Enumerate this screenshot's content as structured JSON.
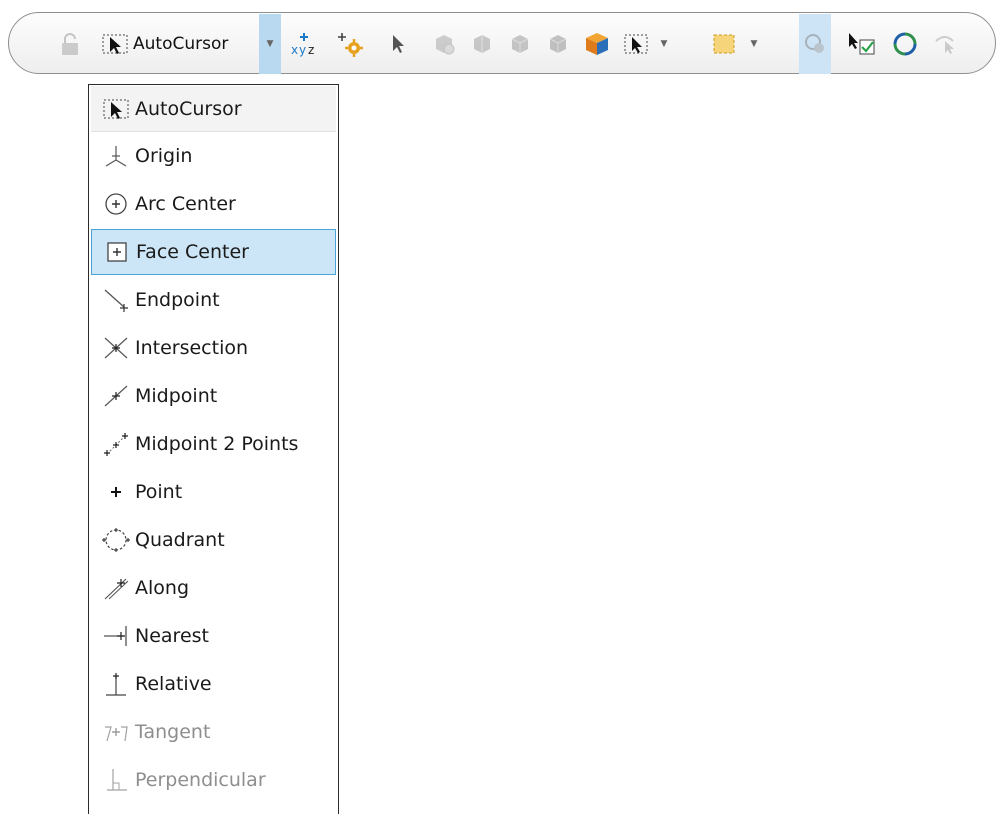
{
  "toolbar": {
    "autocursor_label": "AutoCursor",
    "buttons": [
      {
        "name": "lock-icon"
      },
      {
        "name": "autocursor-icon"
      },
      {
        "name": "dropdown-arrow"
      },
      {
        "name": "xyz-axis-icon"
      },
      {
        "name": "add-gear-icon"
      },
      {
        "name": "select-arrow-icon"
      },
      {
        "name": "box-tool-icons"
      },
      {
        "name": "colored-cube-icon"
      },
      {
        "name": "marquee-select-icon"
      },
      {
        "name": "rectangle-select-icon"
      },
      {
        "name": "select-filter-icon"
      },
      {
        "name": "select-check-icon"
      },
      {
        "name": "refresh-icon"
      },
      {
        "name": "undo-select-icon"
      }
    ]
  },
  "menu": {
    "selected": "Face Center",
    "items": [
      {
        "label": "AutoCursor",
        "icon": "autocursor-icon",
        "state": "header"
      },
      {
        "label": "Origin",
        "icon": "origin-icon",
        "state": "normal"
      },
      {
        "label": "Arc Center",
        "icon": "arc-center-icon",
        "state": "normal"
      },
      {
        "label": "Face Center",
        "icon": "face-center-icon",
        "state": "highlighted"
      },
      {
        "label": "Endpoint",
        "icon": "endpoint-icon",
        "state": "normal"
      },
      {
        "label": "Intersection",
        "icon": "intersection-icon",
        "state": "normal"
      },
      {
        "label": "Midpoint",
        "icon": "midpoint-icon",
        "state": "normal"
      },
      {
        "label": "Midpoint 2 Points",
        "icon": "midpoint-2-points-icon",
        "state": "normal"
      },
      {
        "label": "Point",
        "icon": "point-icon",
        "state": "normal"
      },
      {
        "label": "Quadrant",
        "icon": "quadrant-icon",
        "state": "normal"
      },
      {
        "label": "Along",
        "icon": "along-icon",
        "state": "normal"
      },
      {
        "label": "Nearest",
        "icon": "nearest-icon",
        "state": "normal"
      },
      {
        "label": "Relative",
        "icon": "relative-icon",
        "state": "normal"
      },
      {
        "label": "Tangent",
        "icon": "tangent-icon",
        "state": "disabled"
      },
      {
        "label": "Perpendicular",
        "icon": "perpendicular-icon",
        "state": "disabled"
      }
    ]
  },
  "colors": {
    "highlight_bg": "#cde6f7",
    "highlight_border": "#49a3d6",
    "dropdown_active": "#b9d9f0",
    "disabled_text": "#8e8e8e"
  }
}
